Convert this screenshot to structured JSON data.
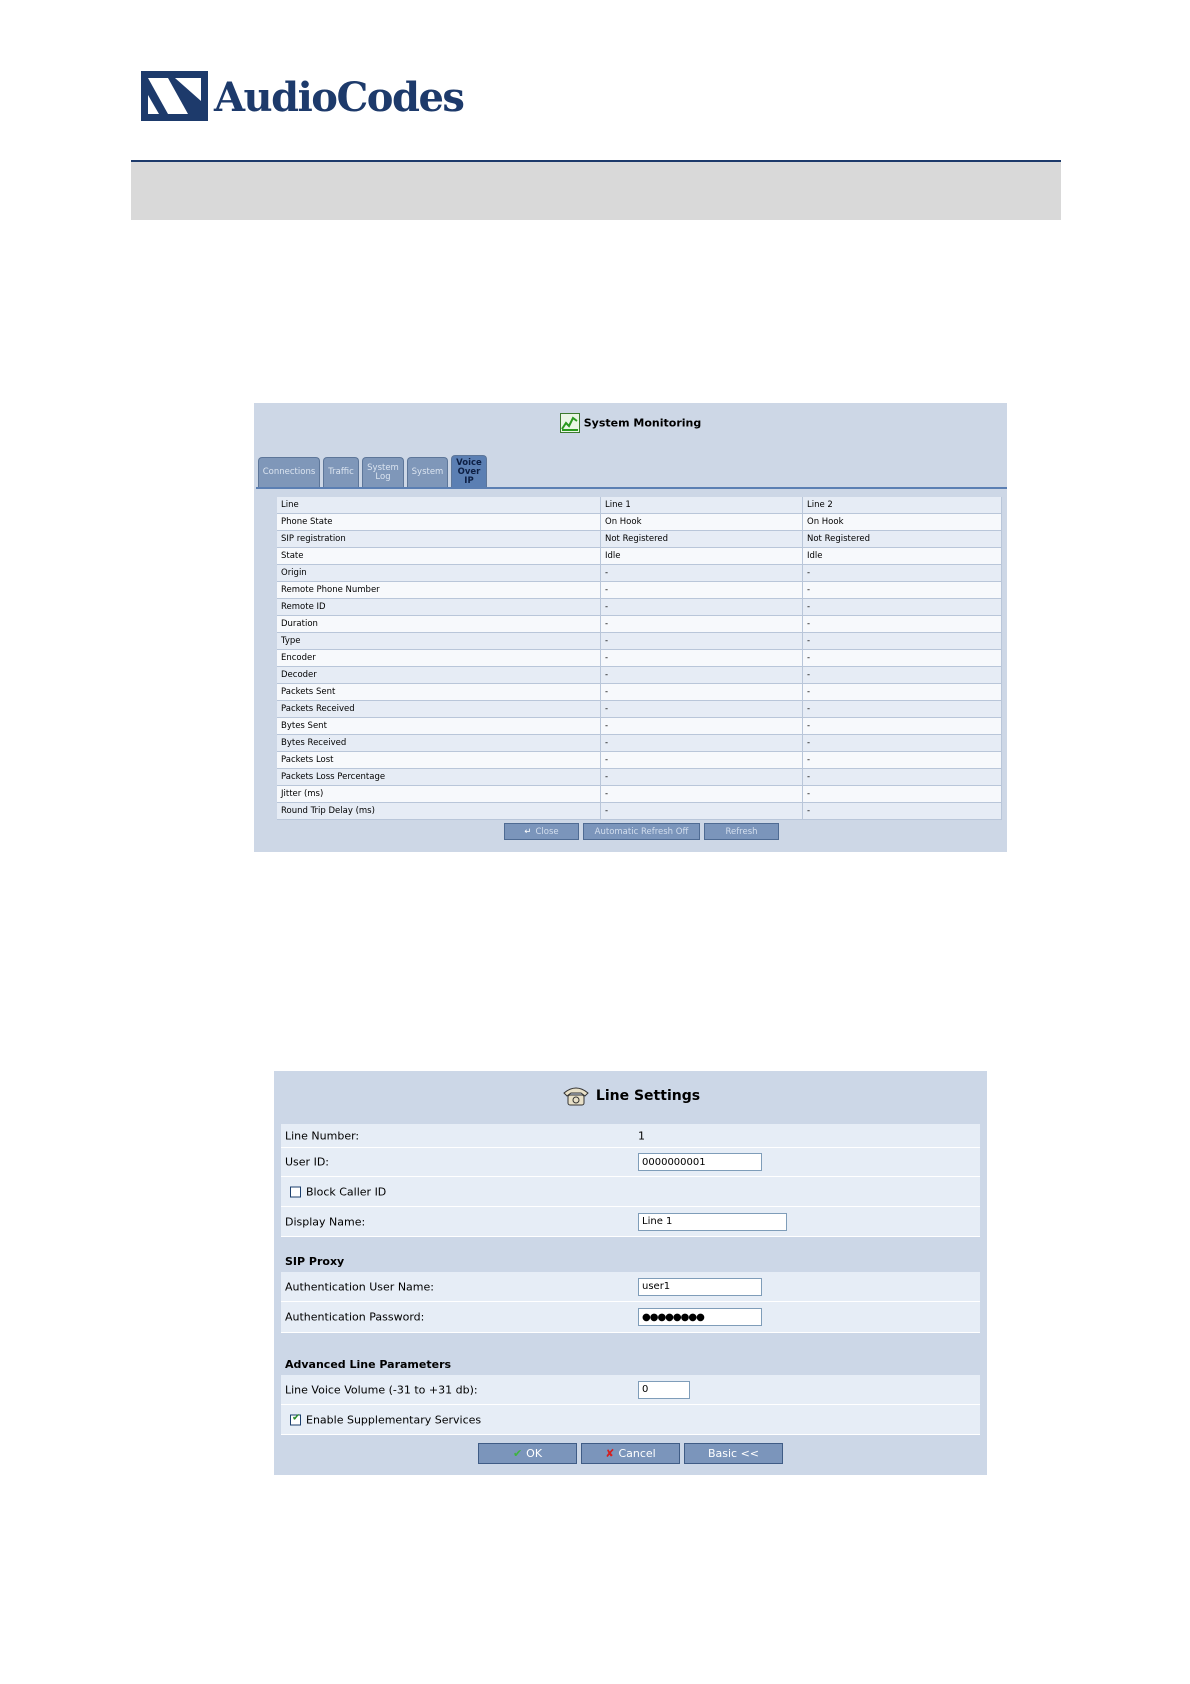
{
  "logo": {
    "text": "AudioCodes"
  },
  "system_monitoring": {
    "title": "System Monitoring",
    "tabs": [
      {
        "label": "Connections"
      },
      {
        "label": "Traffic"
      },
      {
        "label": "System Log"
      },
      {
        "label": "System"
      },
      {
        "label": "Voice Over IP",
        "active": true
      }
    ],
    "header": [
      "Line",
      "Line 1",
      "Line 2"
    ],
    "rows": [
      [
        "Phone State",
        "On Hook",
        "On Hook"
      ],
      [
        "SIP registration",
        "Not Registered",
        "Not Registered"
      ],
      [
        "State",
        "Idle",
        "Idle"
      ],
      [
        "Origin",
        "-",
        "-"
      ],
      [
        "Remote Phone Number",
        "-",
        "-"
      ],
      [
        "Remote ID",
        "-",
        "-"
      ],
      [
        "Duration",
        "-",
        "-"
      ],
      [
        "Type",
        "-",
        "-"
      ],
      [
        "Encoder",
        "-",
        "-"
      ],
      [
        "Decoder",
        "-",
        "-"
      ],
      [
        "Packets Sent",
        "-",
        "-"
      ],
      [
        "Packets Received",
        "-",
        "-"
      ],
      [
        "Bytes Sent",
        "-",
        "-"
      ],
      [
        "Bytes Received",
        "-",
        "-"
      ],
      [
        "Packets Lost",
        "-",
        "-"
      ],
      [
        "Packets Loss Percentage",
        "-",
        "-"
      ],
      [
        "Jitter (ms)",
        "-",
        "-"
      ],
      [
        "Round Trip Delay (ms)",
        "-",
        "-"
      ]
    ],
    "buttons": {
      "close": "Close",
      "auto_refresh": "Automatic Refresh Off",
      "refresh": "Refresh"
    }
  },
  "line_settings": {
    "title": "Line Settings",
    "line_number_label": "Line Number:",
    "line_number_value": "1",
    "user_id_label": "User ID:",
    "user_id_value": "0000000001",
    "block_caller_id_label": "Block Caller ID",
    "block_caller_id_checked": false,
    "display_name_label": "Display Name:",
    "display_name_value": "Line 1",
    "sip_proxy_heading": "SIP Proxy",
    "auth_user_label": "Authentication User Name:",
    "auth_user_value": "user1",
    "auth_password_label": "Authentication Password:",
    "auth_password_value": "●●●●●●●●",
    "advanced_heading": "Advanced Line Parameters",
    "volume_label": "Line Voice Volume (-31 to +31 db):",
    "volume_value": "0",
    "supp_services_label": "Enable Supplementary Services",
    "supp_services_checked": true,
    "buttons": {
      "ok": "OK",
      "cancel": "Cancel",
      "basic": "Basic <<"
    }
  }
}
